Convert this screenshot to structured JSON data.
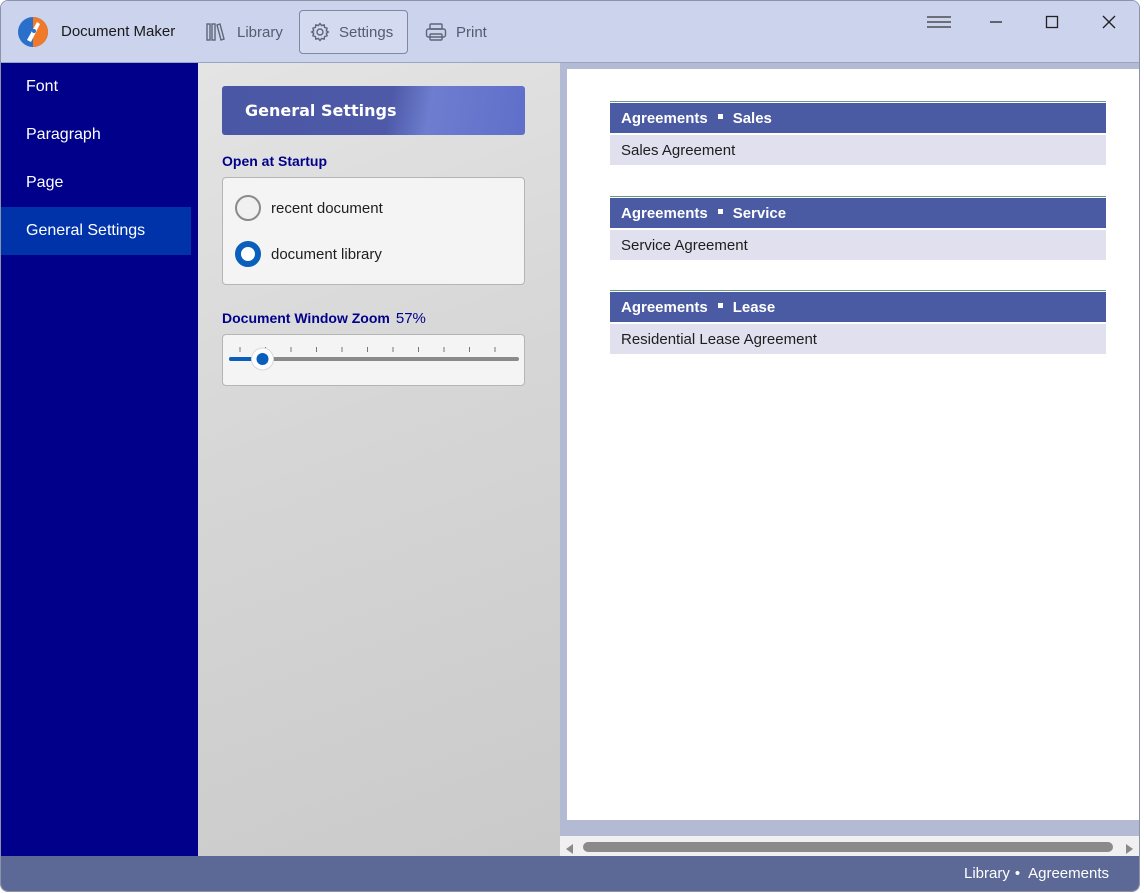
{
  "app": {
    "title": "Document Maker",
    "colors": {
      "titlebar": "#cbd3ed",
      "sidebar": "#00008b",
      "sidebar_selected": "#0033aa",
      "accent": "#0a5fbd",
      "header": "#4a5aa3",
      "statusbar": "#5c6896"
    }
  },
  "toolbar": {
    "library_label": "Library",
    "settings_label": "Settings",
    "print_label": "Print",
    "active": "Settings"
  },
  "window_controls": [
    "menu-icon",
    "minimize-icon",
    "maximize-icon",
    "close-icon"
  ],
  "sidebar": {
    "items": [
      {
        "label": "Font"
      },
      {
        "label": "Paragraph"
      },
      {
        "label": "Page"
      },
      {
        "label": "General Settings",
        "selected": true
      }
    ]
  },
  "settings": {
    "header": "General Settings",
    "startup": {
      "label": "Open at Startup",
      "options": [
        {
          "label": "recent document",
          "checked": false
        },
        {
          "label": "document library",
          "checked": true
        }
      ]
    },
    "zoom": {
      "label": "Document Window Zoom",
      "value_text": "57%",
      "level_fraction": 0.05
    }
  },
  "documents": [
    {
      "category": "Agreements",
      "subcategory": "Sales",
      "item": "Sales Agreement"
    },
    {
      "category": "Agreements",
      "subcategory": "Service",
      "item": "Service Agreement"
    },
    {
      "category": "Agreements",
      "subcategory": "Lease",
      "item": "Residential Lease Agreement"
    }
  ],
  "status": {
    "crumb1": "Library",
    "crumb2": "Agreements"
  }
}
